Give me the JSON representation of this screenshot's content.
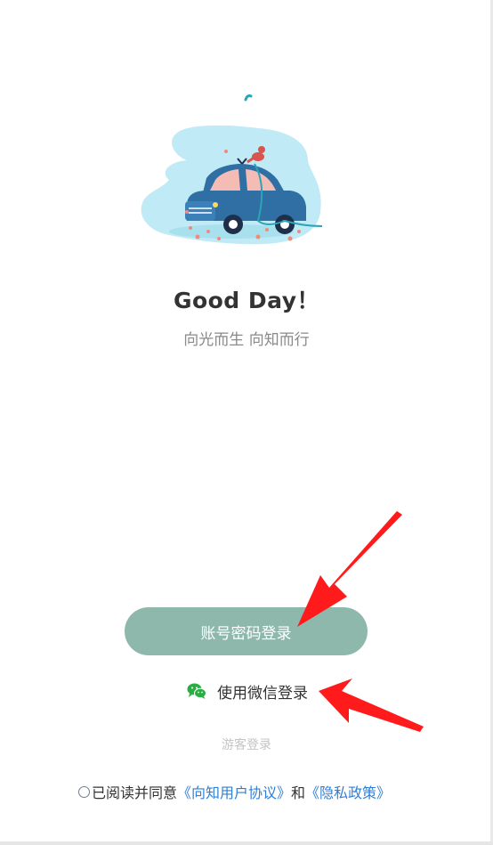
{
  "header": {
    "greeting": "Good Day！",
    "slogan": "向光而生 向知而行"
  },
  "actions": {
    "password_login_label": "账号密码登录",
    "wechat_login_label": "使用微信登录",
    "guest_login_label": "游客登录"
  },
  "agreement": {
    "prefix": "已阅读并同意",
    "user_agreement": "《向知用户协议》",
    "connector": "和",
    "privacy_policy": "《隐私政策》"
  },
  "icons": {
    "wechat": "wechat-icon",
    "illustration": "car-illustration"
  },
  "colors": {
    "primary_button": "#8fb8ad",
    "link": "#2f7fd6",
    "wechat_green": "#2aae43",
    "annotation_arrow": "#ff1b1b"
  }
}
